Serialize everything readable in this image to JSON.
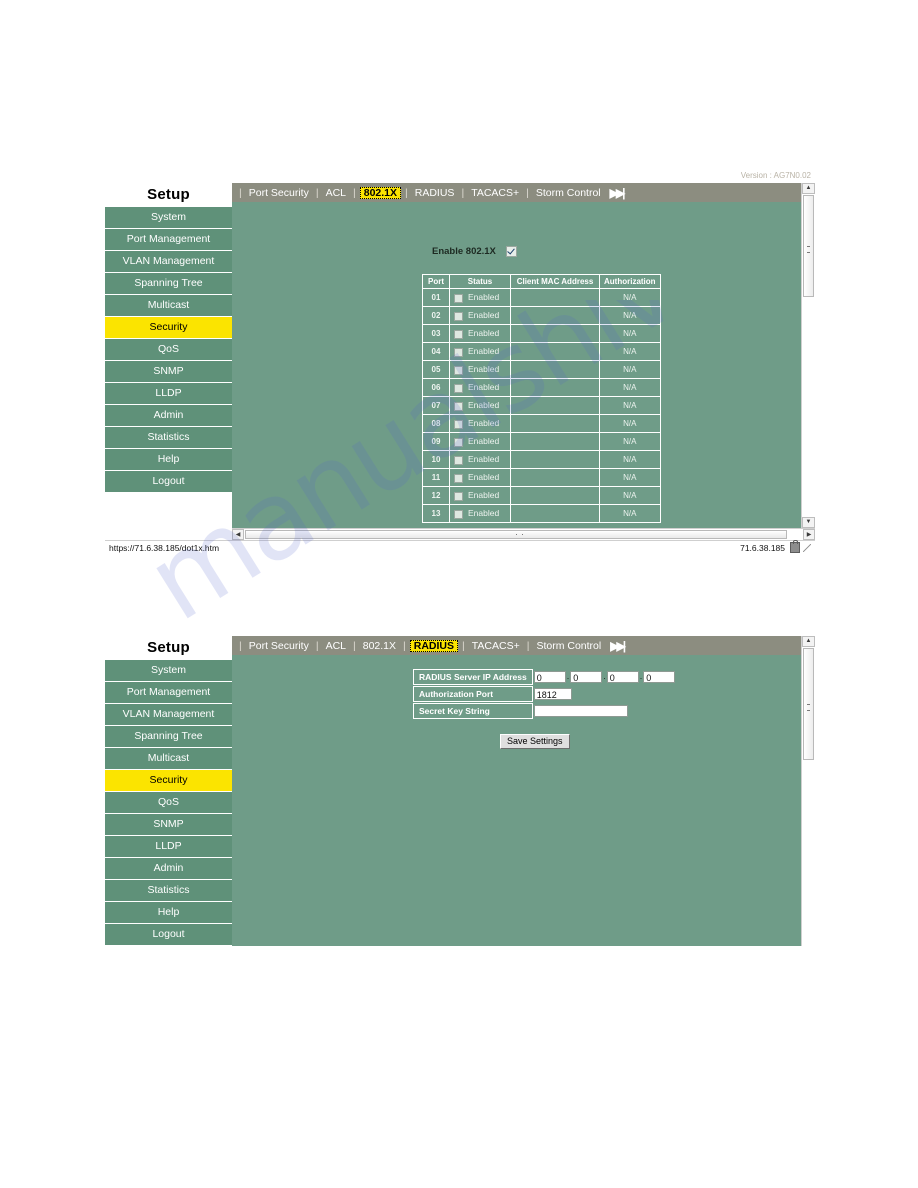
{
  "watermark": {
    "text": "manualshive.com"
  },
  "panel1": {
    "version_text": "Version : AG7N0.02",
    "sidebar": {
      "title": "Setup",
      "items": [
        {
          "label": "System",
          "active": false
        },
        {
          "label": "Port Management",
          "active": false
        },
        {
          "label": "VLAN Management",
          "active": false
        },
        {
          "label": "Spanning Tree",
          "active": false
        },
        {
          "label": "Multicast",
          "active": false
        },
        {
          "label": "Security",
          "active": true
        },
        {
          "label": "QoS",
          "active": false
        },
        {
          "label": "SNMP",
          "active": false
        },
        {
          "label": "LLDP",
          "active": false
        },
        {
          "label": "Admin",
          "active": false
        },
        {
          "label": "Statistics",
          "active": false
        },
        {
          "label": "Help",
          "active": false
        },
        {
          "label": "Logout",
          "active": false
        }
      ]
    },
    "tabs": [
      {
        "label": "Port Security",
        "active": false
      },
      {
        "label": "ACL",
        "active": false
      },
      {
        "label": "802.1X",
        "active": true
      },
      {
        "label": "RADIUS",
        "active": false
      },
      {
        "label": "TACACS+",
        "active": false
      },
      {
        "label": "Storm Control",
        "active": false
      }
    ],
    "skip_icon": "skip-forward-icon",
    "enable_label": "Enable 802.1X",
    "enable_checked": true,
    "table": {
      "headers": [
        "Port",
        "Status",
        "Client MAC Address",
        "Authorization"
      ],
      "rows": [
        {
          "port": "01",
          "status": "Enabled",
          "checked": false,
          "mac": "",
          "auth": "N/A"
        },
        {
          "port": "02",
          "status": "Enabled",
          "checked": false,
          "mac": "",
          "auth": "N/A"
        },
        {
          "port": "03",
          "status": "Enabled",
          "checked": false,
          "mac": "",
          "auth": "N/A"
        },
        {
          "port": "04",
          "status": "Enabled",
          "checked": false,
          "mac": "",
          "auth": "N/A"
        },
        {
          "port": "05",
          "status": "Enabled",
          "checked": false,
          "mac": "",
          "auth": "N/A"
        },
        {
          "port": "06",
          "status": "Enabled",
          "checked": false,
          "mac": "",
          "auth": "N/A"
        },
        {
          "port": "07",
          "status": "Enabled",
          "checked": false,
          "mac": "",
          "auth": "N/A"
        },
        {
          "port": "08",
          "status": "Enabled",
          "checked": false,
          "mac": "",
          "auth": "N/A"
        },
        {
          "port": "09",
          "status": "Enabled",
          "checked": false,
          "mac": "",
          "auth": "N/A"
        },
        {
          "port": "10",
          "status": "Enabled",
          "checked": false,
          "mac": "",
          "auth": "N/A"
        },
        {
          "port": "11",
          "status": "Enabled",
          "checked": false,
          "mac": "",
          "auth": "N/A"
        },
        {
          "port": "12",
          "status": "Enabled",
          "checked": false,
          "mac": "",
          "auth": "N/A"
        },
        {
          "port": "13",
          "status": "Enabled",
          "checked": false,
          "mac": "",
          "auth": "N/A"
        }
      ]
    },
    "statusbar": {
      "url": "https://71.6.38.185/dot1x.htm",
      "zone": "71.6.38.185",
      "lock_icon": "lock-icon"
    }
  },
  "panel2": {
    "sidebar": {
      "title": "Setup",
      "items": [
        {
          "label": "System",
          "active": false
        },
        {
          "label": "Port Management",
          "active": false
        },
        {
          "label": "VLAN Management",
          "active": false
        },
        {
          "label": "Spanning Tree",
          "active": false
        },
        {
          "label": "Multicast",
          "active": false
        },
        {
          "label": "Security",
          "active": true
        },
        {
          "label": "QoS",
          "active": false
        },
        {
          "label": "SNMP",
          "active": false
        },
        {
          "label": "LLDP",
          "active": false
        },
        {
          "label": "Admin",
          "active": false
        },
        {
          "label": "Statistics",
          "active": false
        },
        {
          "label": "Help",
          "active": false
        },
        {
          "label": "Logout",
          "active": false
        }
      ]
    },
    "tabs": [
      {
        "label": "Port Security",
        "active": false
      },
      {
        "label": "ACL",
        "active": false
      },
      {
        "label": "802.1X",
        "active": false
      },
      {
        "label": "RADIUS",
        "active": true
      },
      {
        "label": "TACACS+",
        "active": false
      },
      {
        "label": "Storm Control",
        "active": false
      }
    ],
    "skip_icon": "skip-forward-icon",
    "form": {
      "ip_label": "RADIUS Server IP Address",
      "ip_octets": [
        "0",
        "0",
        "0",
        "0"
      ],
      "port_label": "Authorization Port",
      "port_value": "1812",
      "key_label": "Secret Key String",
      "key_value": "",
      "save_label": "Save Settings"
    }
  },
  "colors": {
    "content_green": "#6f9c88",
    "sidebar_green": "#5f9179",
    "tabbar_gray": "#8c8d80",
    "highlight_yellow": "#fbe400"
  }
}
